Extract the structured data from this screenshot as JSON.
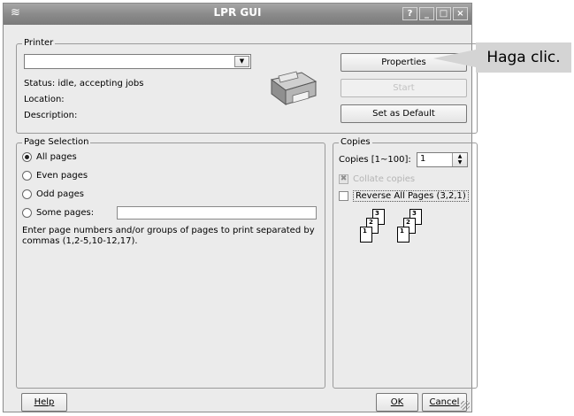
{
  "window": {
    "title": "LPR GUI",
    "help_glyph": "?",
    "minimize_glyph": "_",
    "maximize_glyph": "□",
    "close_glyph": "×"
  },
  "printer": {
    "legend": "Printer",
    "selected_printer": "",
    "status_label": "Status: idle, accepting jobs",
    "location_label": "Location:",
    "description_label": "Description:",
    "properties_label": "Properties",
    "start_label": "Start",
    "set_default_label": "Set as Default"
  },
  "page_selection": {
    "legend": "Page Selection",
    "options": [
      "All pages",
      "Even pages",
      "Odd pages",
      "Some pages:"
    ],
    "selected": "All pages",
    "some_pages_value": "",
    "help_text_line1": "Enter page numbers and/or groups of pages to print separated by",
    "help_text_line2": "commas (1,2-5,10-12,17)."
  },
  "copies": {
    "legend": "Copies",
    "count_label": "Copies [1~100]:",
    "count_value": "1",
    "collate_label": "Collate copies",
    "collate_checked": true,
    "collate_enabled": false,
    "reverse_label": "Reverse All Pages (3,2,1)",
    "reverse_checked": false,
    "page_numbers": [
      "3",
      "2",
      "1"
    ]
  },
  "footer": {
    "help_label": "Help",
    "ok_label": "OK",
    "cancel_label": "Cancel"
  },
  "callout": {
    "text": "Haga clic."
  },
  "icons": {
    "app": "app-icon",
    "printer": "printer-icon",
    "grip": "resize-grip-icon"
  }
}
